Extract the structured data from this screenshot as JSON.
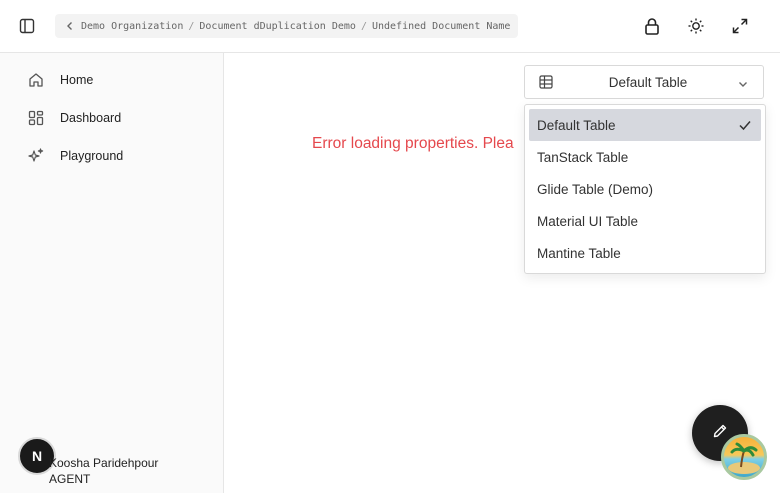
{
  "header": {
    "breadcrumb": [
      "Demo Organization",
      "Document dDuplication Demo",
      "Undefined Document Name"
    ],
    "separator": "/"
  },
  "sidebar": {
    "items": [
      {
        "label": "Home",
        "icon": "home-icon"
      },
      {
        "label": "Dashboard",
        "icon": "dashboard-icon"
      },
      {
        "label": "Playground",
        "icon": "sparkles-icon"
      }
    ],
    "user": {
      "initial": "N",
      "name": "Koosha Paridehpour",
      "role": "AGENT"
    }
  },
  "main": {
    "error_text": "Error loading properties. Plea",
    "error_color": "#e5484d"
  },
  "table_select": {
    "value": "Default Table",
    "options": [
      "Default Table",
      "TanStack Table",
      "Glide Table (Demo)",
      "Material UI Table",
      "Mantine Table"
    ],
    "selected_index": 0
  }
}
